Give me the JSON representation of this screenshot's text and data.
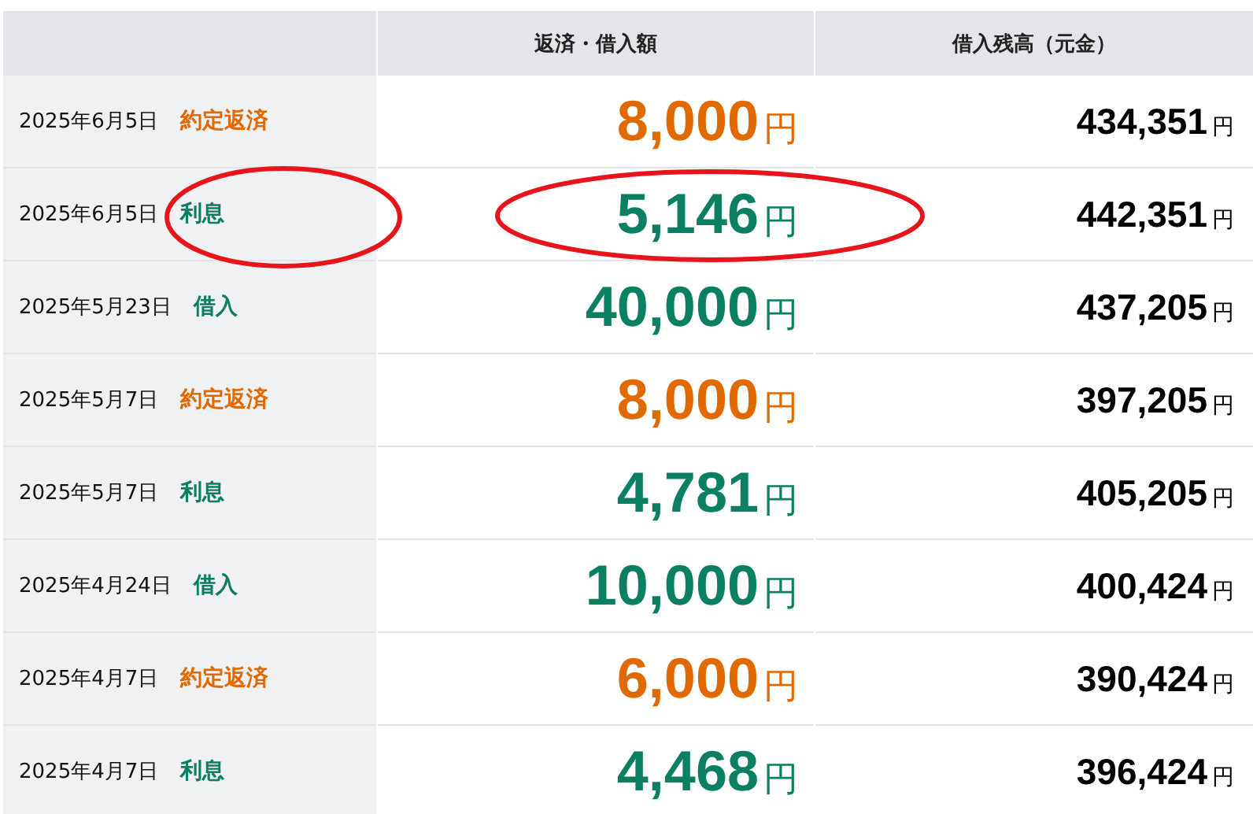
{
  "table": {
    "columns": [
      "返済・借入額",
      "借入残高（元金）"
    ],
    "rows": [
      {
        "date": "2025年6月5日",
        "type": "約定返済",
        "kind": "repayment",
        "amount": "8,000",
        "amount_unit": "円",
        "balance": "434,351",
        "balance_unit": "円",
        "circled": false
      },
      {
        "date": "2025年6月5日",
        "type": "利息",
        "kind": "interest",
        "amount": "5,146",
        "amount_unit": "円",
        "balance": "442,351",
        "balance_unit": "円",
        "circled": true
      },
      {
        "date": "2025年5月23日",
        "type": "借入",
        "kind": "borrowing",
        "amount": "40,000",
        "amount_unit": "円",
        "balance": "437,205",
        "balance_unit": "円",
        "circled": false
      },
      {
        "date": "2025年5月7日",
        "type": "約定返済",
        "kind": "repayment",
        "amount": "8,000",
        "amount_unit": "円",
        "balance": "397,205",
        "balance_unit": "円",
        "circled": false
      },
      {
        "date": "2025年5月7日",
        "type": "利息",
        "kind": "interest",
        "amount": "4,781",
        "amount_unit": "円",
        "balance": "405,205",
        "balance_unit": "円",
        "circled": false
      },
      {
        "date": "2025年4月24日",
        "type": "借入",
        "kind": "borrowing",
        "amount": "10,000",
        "amount_unit": "円",
        "balance": "400,424",
        "balance_unit": "円",
        "circled": false
      },
      {
        "date": "2025年4月7日",
        "type": "約定返済",
        "kind": "repayment",
        "amount": "6,000",
        "amount_unit": "円",
        "balance": "390,424",
        "balance_unit": "円",
        "circled": false
      },
      {
        "date": "2025年4月7日",
        "type": "利息",
        "kind": "interest",
        "amount": "4,468",
        "amount_unit": "円",
        "balance": "396,424",
        "balance_unit": "円",
        "circled": false
      }
    ]
  }
}
